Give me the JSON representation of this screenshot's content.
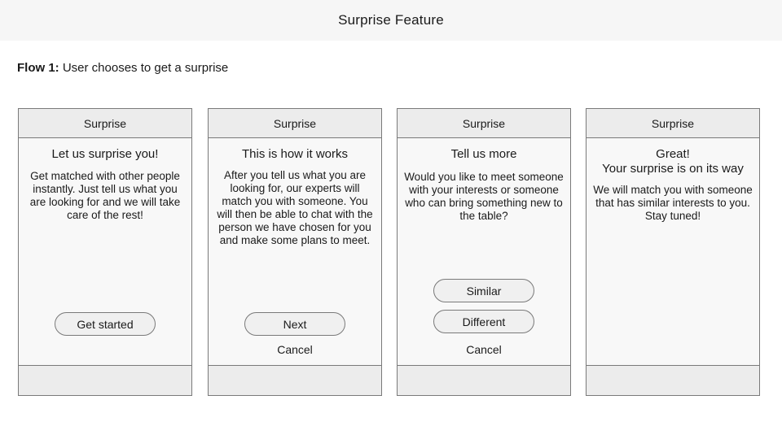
{
  "page": {
    "title": "Surprise Feature"
  },
  "flow": {
    "label": "Flow 1:",
    "description": "User chooses to get a surprise"
  },
  "screens": [
    {
      "header": "Surprise",
      "heading": "Let us surprise you!",
      "body": "Get matched with other people instantly. Just tell us what you are looking for and we will take care of the rest!",
      "primary_button": "Get started"
    },
    {
      "header": "Surprise",
      "heading": "This is how it works",
      "body": "After you tell us what you are looking for, our experts will match you with someone. You will then be able to chat with the person we have chosen for you and make some plans to meet.",
      "primary_button": "Next",
      "cancel": "Cancel"
    },
    {
      "header": "Surprise",
      "heading": "Tell us more",
      "body": "Would you like to meet someone with your interests or someone who can bring something new to the table?",
      "option_1": "Similar",
      "option_2": "Different",
      "cancel": "Cancel"
    },
    {
      "header": "Surprise",
      "heading_line1": "Great!",
      "heading_line2": "Your surprise is on its way",
      "body": "We will match you with someone that has similar interests to you. Stay tuned!"
    }
  ]
}
